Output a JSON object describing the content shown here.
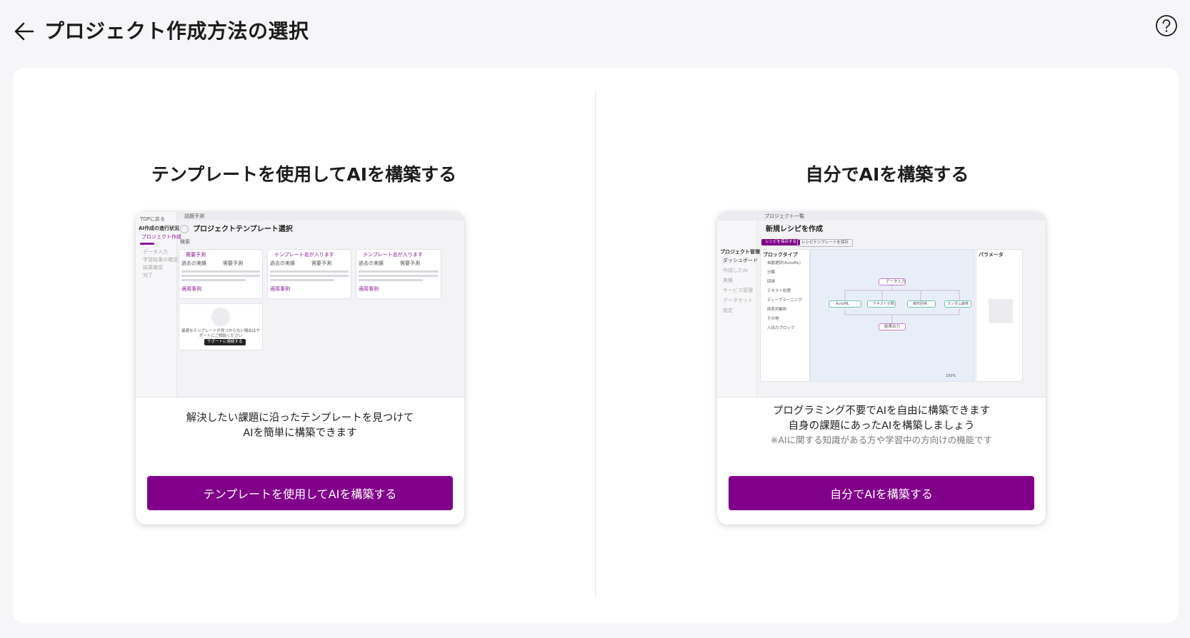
{
  "header": {
    "title": "プロジェクト作成方法の選択"
  },
  "template_option": {
    "heading": "テンプレートを使用してAIを構築する",
    "desc_line1": "解決したい課題に沿ったテンプレートを見つけて",
    "desc_line2": "AIを簡単に構築できます",
    "button_label": "テンプレートを使用してAIを構築する",
    "preview": {
      "back_label": "TOPに戻る",
      "tab_label": "話題予測",
      "sidebar_heading": "AI作成の進行状況",
      "sidebar_items": [
        "プロジェクト作成",
        "データ入力",
        "学習結果の確認",
        "結果確認",
        "完了"
      ],
      "page_title": "プロジェクトテンプレート選択",
      "search_label": "検索",
      "cards": [
        {
          "title": "需要予測",
          "label_a": "過去の実績",
          "label_b": "需要予測",
          "label_c": "適用事例"
        },
        {
          "title": "テンプレート名が入ります",
          "label_a": "過去の実績",
          "label_b": "需要予測",
          "label_c": "適用事例"
        },
        {
          "title": "テンプレート名が入ります",
          "label_a": "過去の実績",
          "label_b": "需要予測",
          "label_c": "適用事例"
        }
      ],
      "empty_text": "最適なテンプレートが見つからない場合はサポートにご相談ください",
      "empty_button": "サポートに連絡する"
    }
  },
  "custom_option": {
    "heading": "自分でAIを構築する",
    "desc_line1": "プログラミング不要でAIを自由に構築できます",
    "desc_line2": "自身の課題にあったAIを構築しましょう",
    "note": "※AIに関する知識がある方や学習中の方向けの機能です",
    "button_label": "自分でAIを構築する",
    "preview": {
      "tab_label": "プロジェクト一覧",
      "page_title": "新規レシピを作成",
      "btn_primary": "レシピを保存する",
      "btn_secondary": "レシピテンプレートを保存",
      "sidebar_heading": "プロジェクト管理",
      "sidebar_items": [
        "ダッシュボード",
        "作成したAI",
        "実績",
        "サービス管理",
        "データセット",
        "設定"
      ],
      "block_heading": "ブロックタイプ",
      "blocks": [
        "自動選択(AutoML)",
        "分類",
        "回帰",
        "テキスト処理",
        "ディープラーニング",
        "時系列解析",
        "その他",
        "入出力ブロック"
      ],
      "param_heading": "パラメータ",
      "nodes": [
        "データ入力",
        "AutoML",
        "テキスト分類",
        "線形回帰",
        "ランダム森林",
        "結果出力"
      ],
      "zoom": "100%"
    }
  },
  "colors": {
    "accent": "#80008a",
    "background": "#f6f6f9"
  }
}
